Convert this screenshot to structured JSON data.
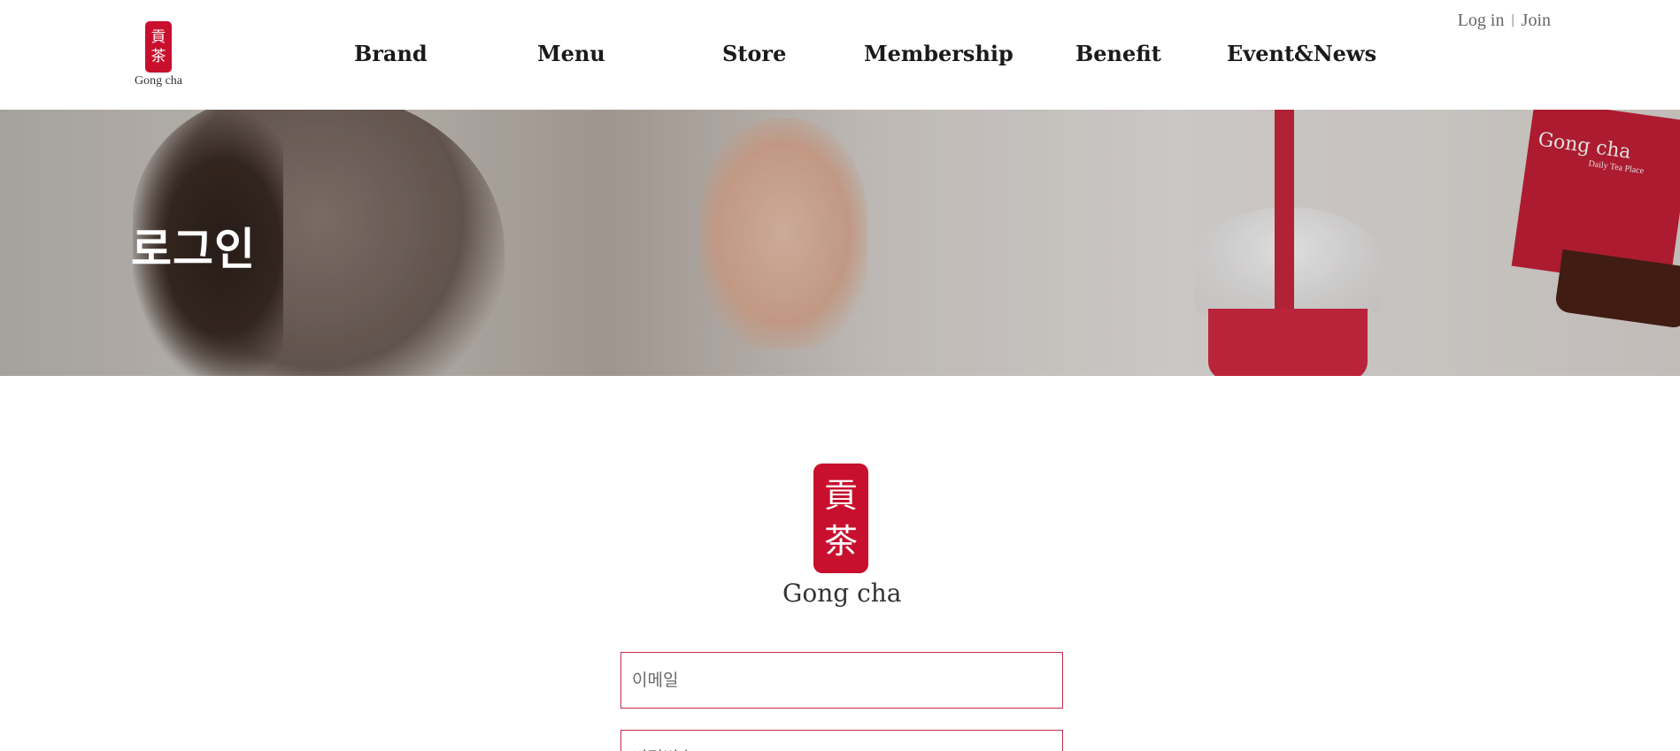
{
  "header": {
    "logo": {
      "name": "Gong cha",
      "seal_chars": [
        "貢",
        "茶"
      ]
    },
    "nav": [
      "Brand",
      "Menu",
      "Store",
      "Membership",
      "Benefit",
      "Event&News"
    ],
    "util": {
      "login": "Log in",
      "separator": "|",
      "join": "Join"
    }
  },
  "hero": {
    "title": "로그인",
    "cup_print": {
      "brand": "Gong cha",
      "tagline": "Daily Tea Place"
    }
  },
  "login": {
    "logo": {
      "name": "Gong cha",
      "seal_chars": [
        "貢",
        "茶"
      ]
    },
    "email_placeholder": "이메일",
    "password_placeholder": "비밀번호"
  },
  "colors": {
    "brand_red": "#c8102e",
    "field_border": "#c8284b"
  }
}
